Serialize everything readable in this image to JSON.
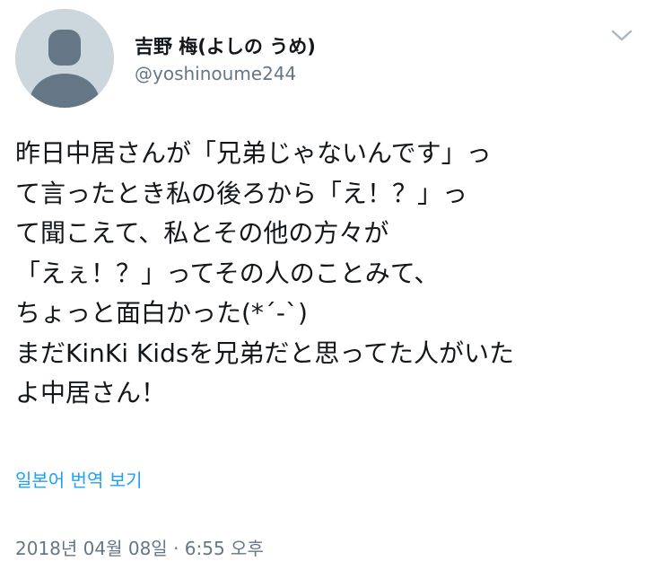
{
  "author": {
    "display_name": "吉野 梅(よしの うめ)",
    "handle": "@yoshinoume244",
    "avatar_icon": "default-profile-icon"
  },
  "menu": {
    "caret_icon": "chevron-down-icon"
  },
  "tweet": {
    "lines": [
      "昨日中居さんが「兄弟じゃないんです」っ",
      "て言ったとき私の後ろから「え！？」っ",
      "て聞こえて、私とその他の方々が",
      "「えぇ！？」ってその人のことみて、",
      "ちょっと面白かった(*´-`)",
      "まだKinKi Kidsを兄弟だと思ってた人がいた",
      "よ中居さん！"
    ]
  },
  "translate_label": "일본어 번역 보기",
  "timestamp": "2018년 04월 08일 · 6:55 오후",
  "colors": {
    "text": "#14171a",
    "secondary": "#657786",
    "link": "#1da1f2",
    "avatar_bg": "#ccd6dd",
    "avatar_fg": "#657786"
  }
}
